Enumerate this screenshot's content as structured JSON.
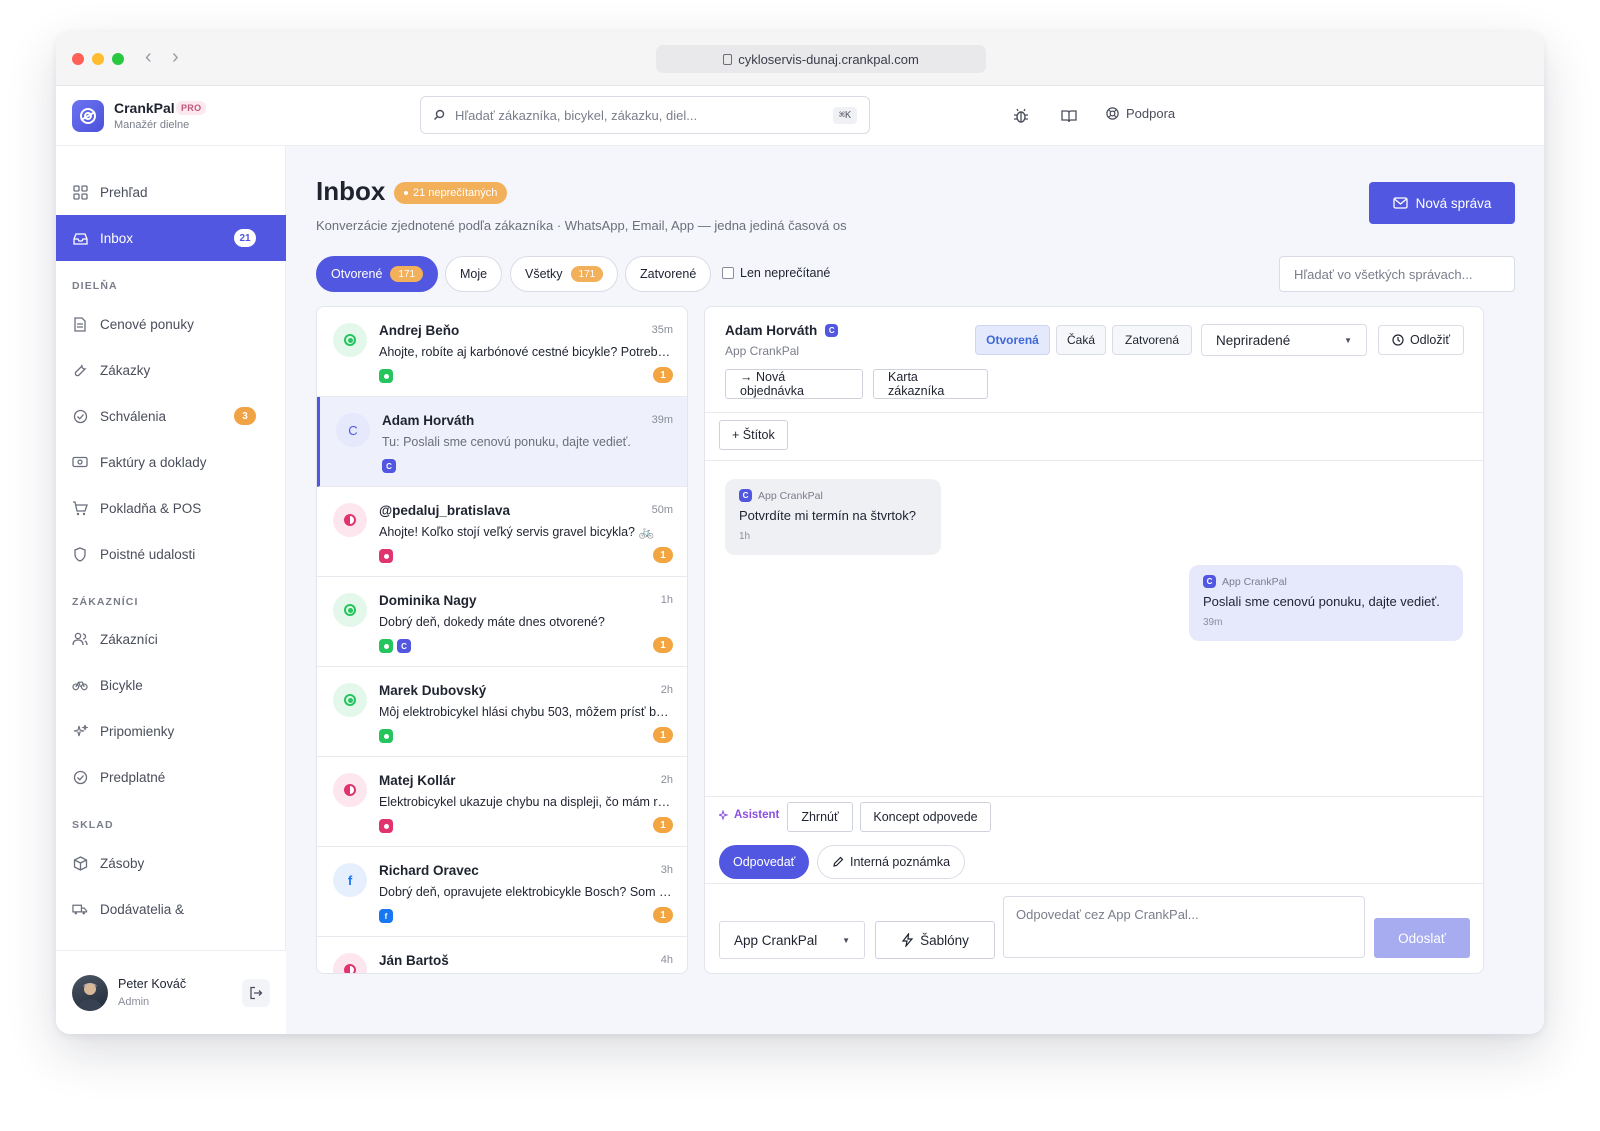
{
  "browser": {
    "url": "cykloservis-dunaj.crankpal.com"
  },
  "brand": {
    "name": "CrankPal",
    "badge": "PRO",
    "subtitle": "Manažér dielne"
  },
  "topbar": {
    "search_placeholder": "Hľadať zákazníka, bicykel, zákazku, diel...",
    "search_shortcut": "⌘K",
    "support_label": "Podpora"
  },
  "sidebar": {
    "items_top": [
      {
        "label": "Prehľad"
      },
      {
        "label": "Inbox",
        "badge": "21"
      }
    ],
    "sections": [
      {
        "title": "DIELŇA",
        "items": [
          {
            "label": "Cenové ponuky"
          },
          {
            "label": "Zákazky"
          },
          {
            "label": "Schválenia",
            "badge": "3"
          },
          {
            "label": "Faktúry a doklady"
          },
          {
            "label": "Pokladňa & POS"
          },
          {
            "label": "Poistné udalosti"
          }
        ]
      },
      {
        "title": "ZÁKAZNÍCI",
        "items": [
          {
            "label": "Zákazníci"
          },
          {
            "label": "Bicykle"
          },
          {
            "label": "Pripomienky"
          },
          {
            "label": "Predplatné"
          }
        ]
      },
      {
        "title": "SKLAD",
        "items": [
          {
            "label": "Zásoby"
          },
          {
            "label": "Dodávatelia &"
          }
        ]
      }
    ],
    "user": {
      "name": "Peter Kováč",
      "role": "Admin"
    }
  },
  "main": {
    "title": "Inbox",
    "unread_label": "21 neprečítaných",
    "subtitle": "Konverzácie zjednotené podľa zákazníka · WhatsApp, Email, App — jedna jediná časová os",
    "new_message_label": "Nová správa",
    "filters": [
      {
        "label": "Otvorené",
        "count": "171"
      },
      {
        "label": "Moje"
      },
      {
        "label": "Všetky",
        "count": "171"
      },
      {
        "label": "Zatvorené"
      }
    ],
    "unread_only_label": "Len neprečítané",
    "search_placeholder": "Hľadať vo všetkých správach..."
  },
  "conversations": [
    {
      "name": "Andrej Beňo",
      "time": "35m",
      "preview": "Ahojte, robíte aj karbónové cestné bicykle? Potrebo...",
      "avatar": "wa",
      "chips": [
        "wa"
      ],
      "count": "1"
    },
    {
      "name": "Adam Horváth",
      "time": "39m",
      "preview": "Tu: Poslali sme cenovú ponuku, dajte vedieť.",
      "avatar": "C",
      "chips": [
        "app"
      ],
      "count": ""
    },
    {
      "name": "@pedaluj_bratislava",
      "time": "50m",
      "preview": "Ahojte! Koľko stojí veľký servis gravel bicykla? 🚲",
      "avatar": "ig",
      "chips": [
        "ig"
      ],
      "count": "1"
    },
    {
      "name": "Dominika Nagy",
      "time": "1h",
      "preview": "Dobrý deň, dokedy máte dnes otvorené?",
      "avatar": "wa",
      "chips": [
        "wa",
        "app"
      ],
      "count": "1"
    },
    {
      "name": "Marek Dubovský",
      "time": "2h",
      "preview": "Môj elektrobicykel hlási chybu 503, môžem prísť be...",
      "avatar": "wa",
      "chips": [
        "wa"
      ],
      "count": "1"
    },
    {
      "name": "Matej Kollár",
      "time": "2h",
      "preview": "Elektrobicykel ukazuje chybu na displeji, čo mám ro...",
      "avatar": "ig",
      "chips": [
        "ig"
      ],
      "count": "1"
    },
    {
      "name": "Richard Oravec",
      "time": "3h",
      "preview": "Dobrý deň, opravujete elektrobicykle Bosch? Som z...",
      "avatar": "f",
      "chips": [
        "fb"
      ],
      "count": "1"
    },
    {
      "name": "Ján Bartoš",
      "time": "4h",
      "preview": "",
      "avatar": "ig",
      "chips": [],
      "count": ""
    }
  ],
  "detail": {
    "name": "Adam Horváth",
    "name_badge": "C",
    "channel": "App CrankPal",
    "statuses": [
      "Otvorená",
      "Čaká",
      "Zatvorená"
    ],
    "assignee": "Nepriradené",
    "snooze_label": "Odložiť",
    "new_order_label": "→ Nová objednávka",
    "customer_card_label": "Karta zákazníka",
    "tag_label": "+ Štítok",
    "messages": [
      {
        "source": "App CrankPal",
        "text": "Potvrdíte mi termín na štvrtok?",
        "time": "1h"
      },
      {
        "source": "App CrankPal",
        "text": "Poslali sme cenovú ponuku, dajte vedieť.",
        "time": "39m"
      }
    ],
    "assistant_label": "Asistent",
    "summarize_label": "Zhrnúť",
    "draft_label": "Koncept odpovede",
    "reply_tab": "Odpovedať",
    "note_tab": "Interná poznámka",
    "reply_channel": "App CrankPal",
    "templates_label": "Šablóny",
    "reply_placeholder": "Odpovedať cez App CrankPal...",
    "send_label": "Odoslať"
  },
  "colors": {
    "accent": "#5157e0",
    "orange": "#f2a540",
    "whatsapp": "#25c55e",
    "instagram": "#e0336f",
    "facebook": "#1877f2"
  }
}
